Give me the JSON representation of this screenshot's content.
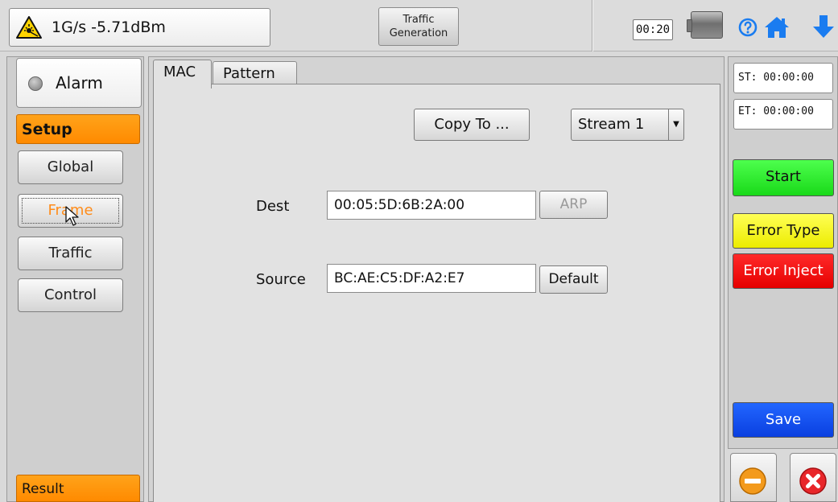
{
  "header": {
    "signal_text": "1G/s -5.71dBm",
    "title_line1": "Traffic",
    "title_line2": "Generation",
    "timer": "00:20",
    "icons": [
      "laser-warning-icon",
      "battery-icon",
      "help-icon",
      "home-icon",
      "arrow-down-icon"
    ]
  },
  "sidebar": {
    "alarm_label": "Alarm",
    "setup_label": "Setup",
    "items": [
      {
        "label": "Global"
      },
      {
        "label": "Frame",
        "active": true
      },
      {
        "label": "Traffic"
      },
      {
        "label": "Control"
      }
    ],
    "result_label": "Result"
  },
  "main": {
    "tabs": [
      {
        "label": "MAC",
        "active": true
      },
      {
        "label": "Pattern"
      }
    ],
    "copy_to_label": "Copy To ...",
    "stream_select": "Stream 1",
    "dest_label": "Dest",
    "dest_value": "00:05:5D:6B:2A:00",
    "arp_label": "ARP",
    "source_label": "Source",
    "source_value": "BC:AE:C5:DF:A2:E7",
    "default_label": "Default"
  },
  "right": {
    "start_time": "ST: 00:00:00",
    "end_time": "ET: 00:00:00",
    "start_label": "Start",
    "error_type_label": "Error Type",
    "error_inject_label": "Error Inject",
    "save_label": "Save"
  },
  "colors": {
    "orange": "#ff8c00",
    "start_green": "#22e022",
    "error_type_yellow": "#f5f500",
    "error_inject_red": "#f00000",
    "save_blue": "#1a50f0",
    "icon_blue": "#1a7cf0"
  }
}
